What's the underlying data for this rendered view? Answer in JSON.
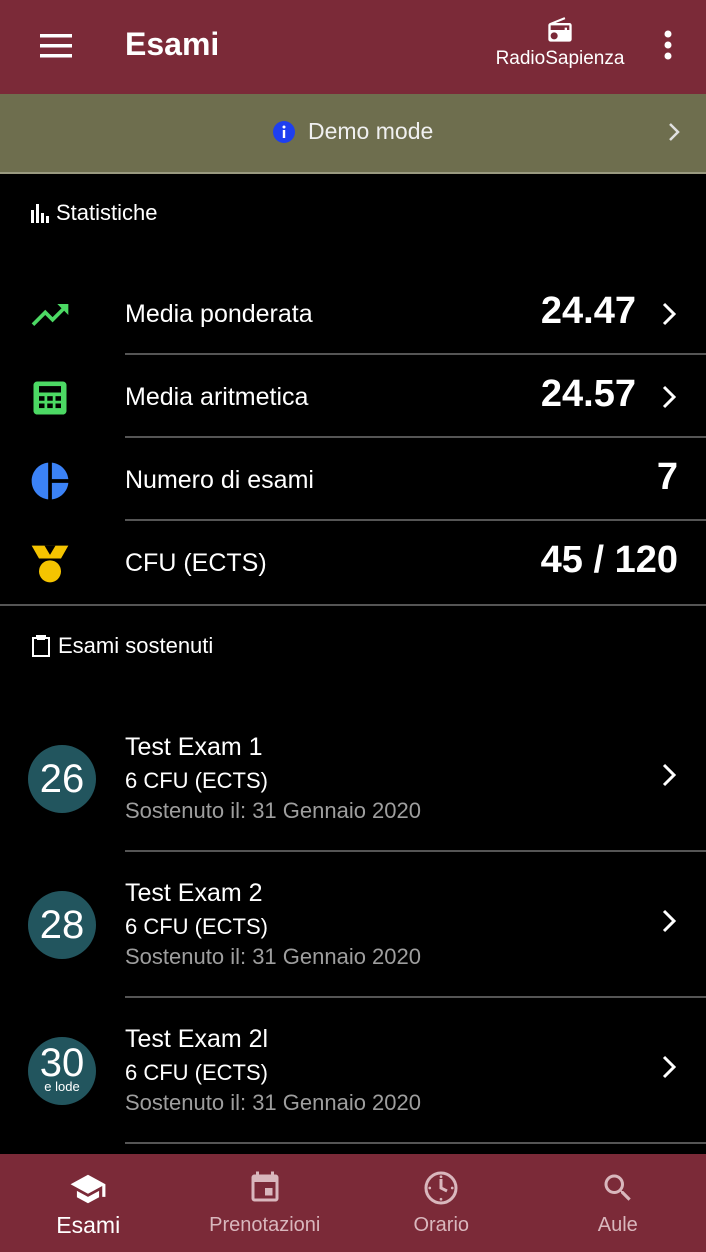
{
  "appbar": {
    "title": "Esami",
    "radio_label": "RadioSapienza",
    "color": "#7b2a38"
  },
  "banner": {
    "text": "Demo mode",
    "icon": "info-icon",
    "color": "#6e6e4e"
  },
  "stats": {
    "header": "Statistiche",
    "rows": [
      {
        "label": "Media ponderata",
        "value": "24.47",
        "icon": "trending-up-icon"
      },
      {
        "label": "Media aritmetica",
        "value": "24.57",
        "icon": "calculator-icon"
      },
      {
        "label": "Numero di esami",
        "value": "7",
        "icon": "pie-chart-icon"
      },
      {
        "label": "CFU (ECTS)",
        "value": "45 / 120",
        "icon": "medal-icon"
      }
    ]
  },
  "exams": {
    "header": "Esami sostenuti",
    "items": [
      {
        "grade": "26",
        "grade_sub": "",
        "name": "Test Exam 1",
        "cfu": "6 CFU (ECTS)",
        "date": "Sostenuto il: 31 Gennaio 2020"
      },
      {
        "grade": "28",
        "grade_sub": "",
        "name": "Test Exam 2",
        "cfu": "6 CFU (ECTS)",
        "date": "Sostenuto il: 31 Gennaio 2020"
      },
      {
        "grade": "30",
        "grade_sub": "e lode",
        "name": "Test Exam 2l",
        "cfu": "6 CFU (ECTS)",
        "date": "Sostenuto il: 31 Gennaio 2020"
      }
    ]
  },
  "nav": {
    "items": [
      {
        "label": "Esami",
        "icon": "school-icon"
      },
      {
        "label": "Prenotazioni",
        "icon": "calendar-icon"
      },
      {
        "label": "Orario",
        "icon": "clock-icon"
      },
      {
        "label": "Aule",
        "icon": "search-icon"
      }
    ],
    "active": "Esami"
  }
}
